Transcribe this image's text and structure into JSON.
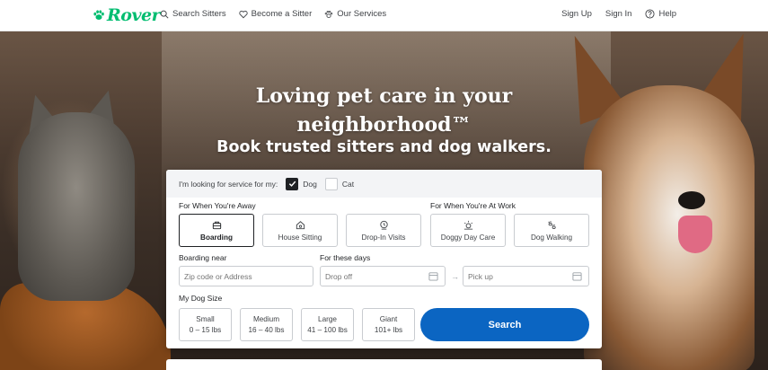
{
  "brand": {
    "name": "Rover",
    "color": "#00bd70"
  },
  "nav": {
    "search_sitters": "Search Sitters",
    "become_sitter": "Become a Sitter",
    "our_services": "Our Services",
    "sign_up": "Sign Up",
    "sign_in": "Sign In",
    "help": "Help"
  },
  "hero": {
    "title": "Loving pet care in your neighborhood™",
    "subtitle": "Book trusted sitters and dog walkers."
  },
  "search": {
    "looking_for_label": "I'm looking for service for my:",
    "pets": [
      {
        "label": "Dog",
        "checked": true
      },
      {
        "label": "Cat",
        "checked": false
      }
    ],
    "away_label": "For When You're Away",
    "work_label": "For When You're At Work",
    "services": [
      {
        "label": "Boarding",
        "icon": "boarding-icon",
        "active": true
      },
      {
        "label": "House Sitting",
        "icon": "house-sitting-icon",
        "active": false
      },
      {
        "label": "Drop-In Visits",
        "icon": "drop-in-icon",
        "active": false
      },
      {
        "label": "Doggy Day Care",
        "icon": "day-care-icon",
        "active": false
      },
      {
        "label": "Dog Walking",
        "icon": "paw-walk-icon",
        "active": false
      }
    ],
    "boarding_near_label": "Boarding near",
    "address_placeholder": "Zip code or Address",
    "dates_label": "For these days",
    "drop_off_placeholder": "Drop off",
    "pick_up_placeholder": "Pick up",
    "dog_size_label": "My Dog Size",
    "sizes": [
      {
        "label": "Small",
        "range": "0 – 15 lbs"
      },
      {
        "label": "Medium",
        "range": "16 – 40 lbs"
      },
      {
        "label": "Large",
        "range": "41 – 100 lbs"
      },
      {
        "label": "Giant",
        "range": "101+ lbs"
      }
    ],
    "search_button": "Search",
    "accent": "#0b65c2"
  }
}
